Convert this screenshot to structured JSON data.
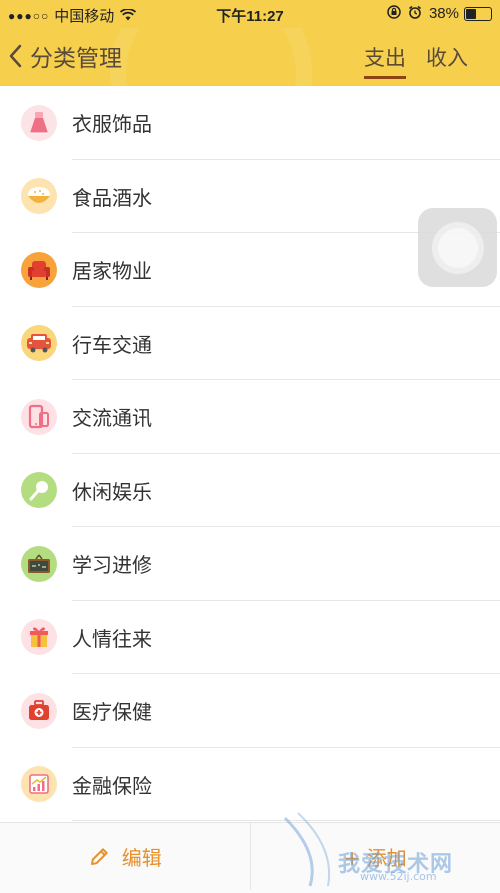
{
  "status_bar": {
    "signal": "●●●○○",
    "carrier": "中国移动",
    "time": "下午11:27",
    "battery_pct": "38%",
    "battery_level": 0.38
  },
  "header": {
    "title": "分类管理",
    "tabs": [
      {
        "label": "支出",
        "active": true
      },
      {
        "label": "收入",
        "active": false
      }
    ]
  },
  "categories": [
    {
      "label": "衣服饰品",
      "icon": "dress-icon",
      "color": "#fbe3e6"
    },
    {
      "label": "食品酒水",
      "icon": "food-bowl-icon",
      "color": "#fde3b0"
    },
    {
      "label": "居家物业",
      "icon": "armchair-icon",
      "color": "#f7a23b"
    },
    {
      "label": "行车交通",
      "icon": "car-icon",
      "color": "#fbd77c"
    },
    {
      "label": "交流通讯",
      "icon": "phone-icon",
      "color": "#fde1e4"
    },
    {
      "label": "休闲娱乐",
      "icon": "microphone-icon",
      "color": "#b4dd82"
    },
    {
      "label": "学习进修",
      "icon": "chalkboard-icon",
      "color": "#b4dd82"
    },
    {
      "label": "人情往来",
      "icon": "gift-icon",
      "color": "#fde1e4"
    },
    {
      "label": "医疗保健",
      "icon": "medical-kit-icon",
      "color": "#fde1e4"
    },
    {
      "label": "金融保险",
      "icon": "chart-icon",
      "color": "#fde3b0"
    }
  ],
  "bottom_bar": {
    "edit_label": "编辑",
    "add_label": "+ 添加"
  },
  "watermark": {
    "text": "我爱技术网",
    "url": "www.52ij.com"
  },
  "colors": {
    "header": "#f6d04d",
    "accent": "#e8902a",
    "tab_underline": "#8b4513"
  }
}
